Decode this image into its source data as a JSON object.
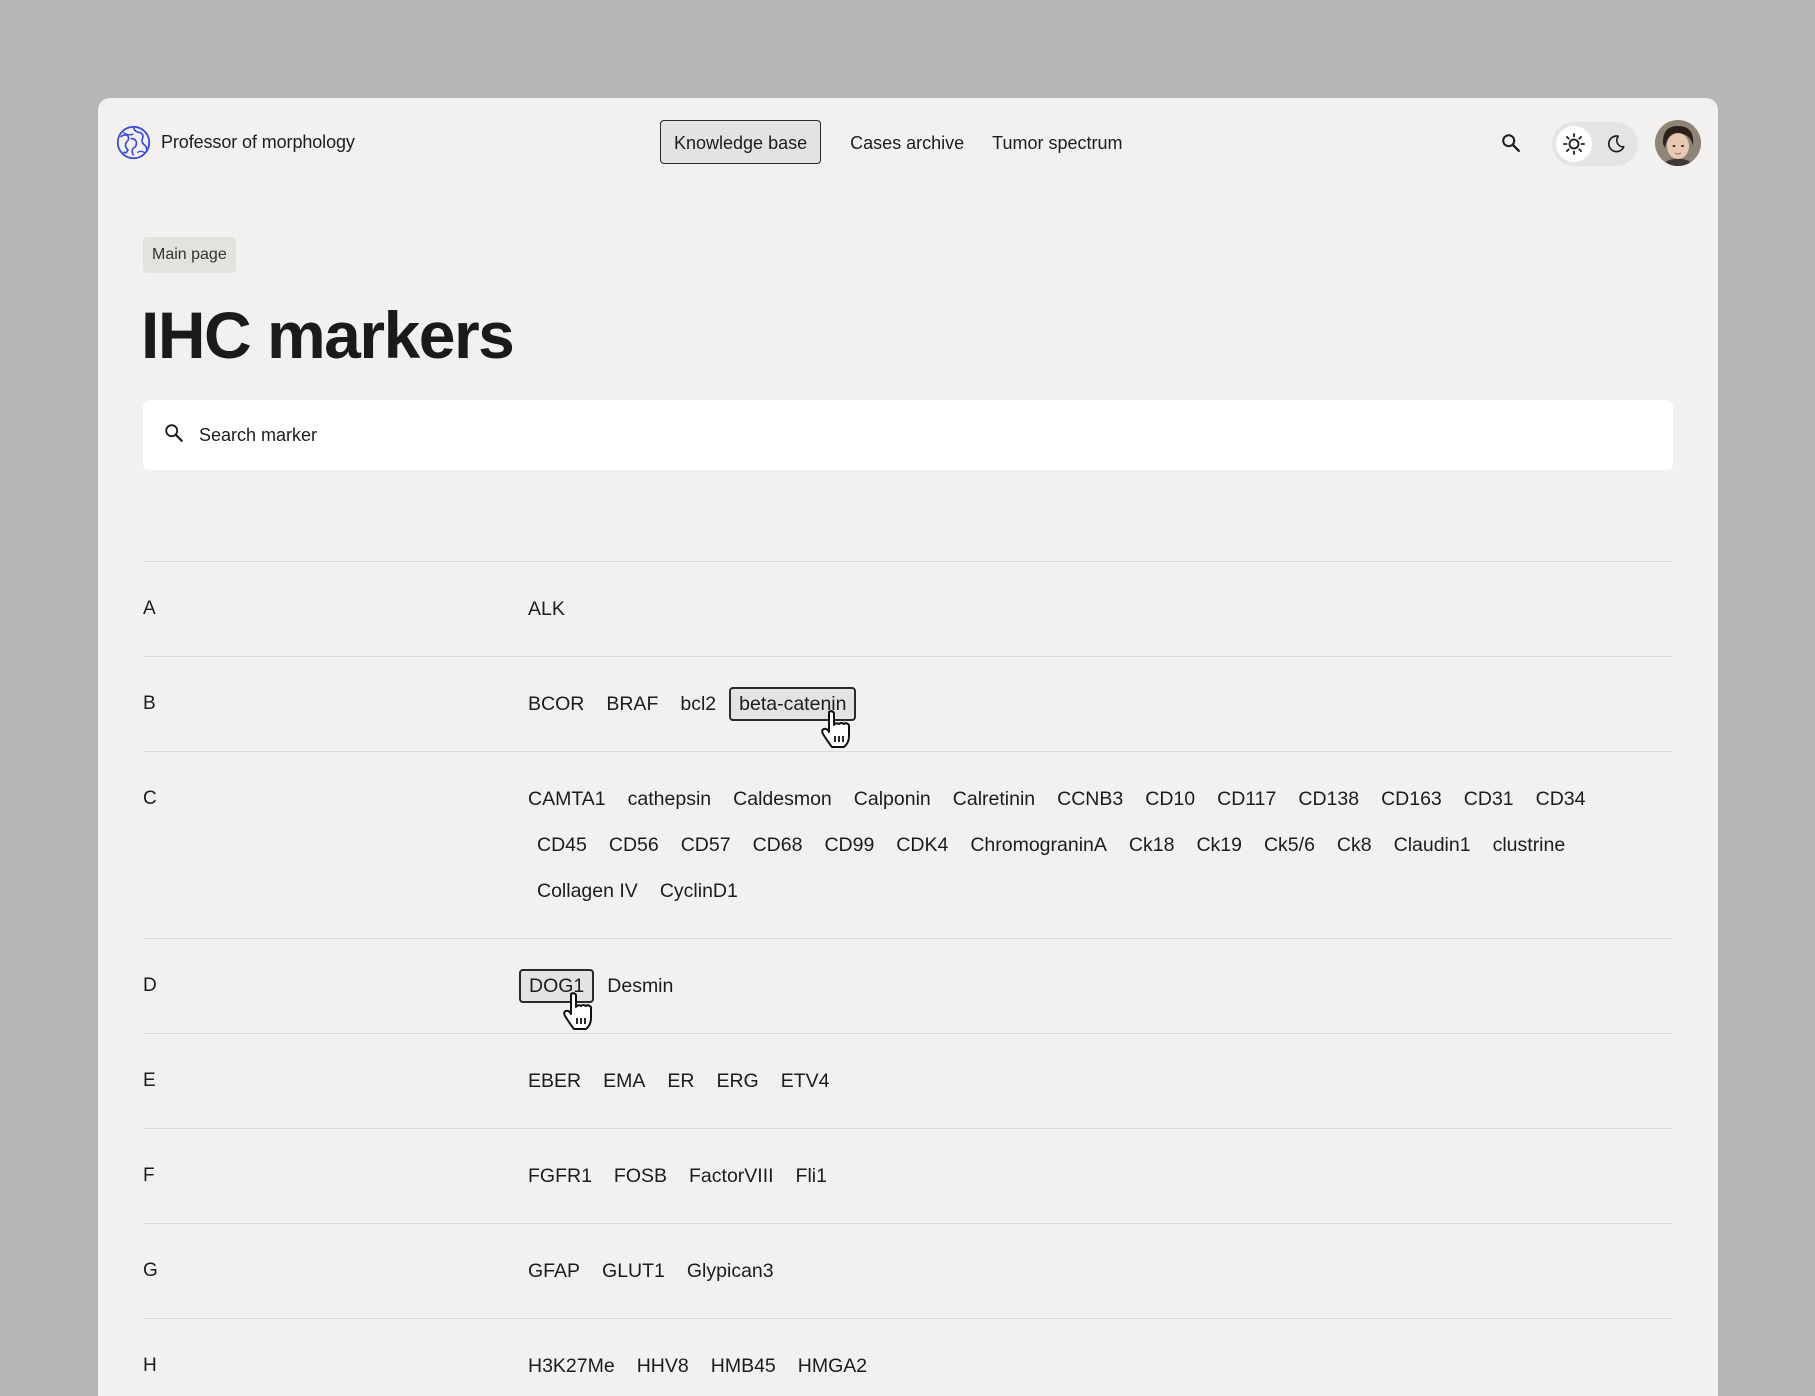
{
  "brand": {
    "name": "Professor of morphology"
  },
  "nav": {
    "items": [
      {
        "label": "Knowledge base",
        "active": true
      },
      {
        "label": "Cases archive",
        "active": false
      },
      {
        "label": "Tumor spectrum",
        "active": false
      }
    ]
  },
  "breadcrumb": {
    "label": "Main page"
  },
  "page": {
    "title": "IHC markers"
  },
  "search": {
    "placeholder": "Search marker"
  },
  "colors": {
    "background": "#f2f1ef",
    "outer": "#b7b6b4",
    "accent": "#3d4fd8",
    "hover": "#e4e3e1"
  },
  "icons": {
    "brand": "globe-logo-icon",
    "search": "search-icon",
    "light": "sun-icon",
    "dark": "moon-icon",
    "cursor": "hand-pointer-icon"
  },
  "groups": [
    {
      "letter": "A",
      "markers": [
        "ALK"
      ]
    },
    {
      "letter": "B",
      "markers": [
        "BCOR",
        "BRAF",
        "bcl2",
        "beta-catenin"
      ],
      "hover": "beta-catenin"
    },
    {
      "letter": "C",
      "markers": [
        "CAMTA1",
        "cathepsin",
        "Caldesmon",
        "Calponin",
        "Calretinin",
        "CCNB3",
        "CD10",
        "CD117",
        "CD138",
        "CD163",
        "CD31",
        "CD34",
        "CD45",
        "CD56",
        "CD57",
        "CD68",
        "CD99",
        "CDK4",
        "ChromograninA",
        "Ck18",
        "Ck19",
        "Ck5/6",
        "Ck8",
        "Claudin1",
        "clustrine",
        "Collagen IV",
        "CyclinD1"
      ]
    },
    {
      "letter": "D",
      "markers": [
        "DOG1",
        "Desmin"
      ],
      "hover": "DOG1"
    },
    {
      "letter": "E",
      "markers": [
        "EBER",
        "EMA",
        "ER",
        "ERG",
        "ETV4"
      ]
    },
    {
      "letter": "F",
      "markers": [
        "FGFR1",
        "FOSB",
        "FactorVIII",
        "Fli1"
      ]
    },
    {
      "letter": "G",
      "markers": [
        "GFAP",
        "GLUT1",
        "Glypican3"
      ]
    },
    {
      "letter": "H",
      "markers": [
        "H3K27Me",
        "HHV8",
        "HMB45",
        "HMGA2"
      ]
    }
  ]
}
